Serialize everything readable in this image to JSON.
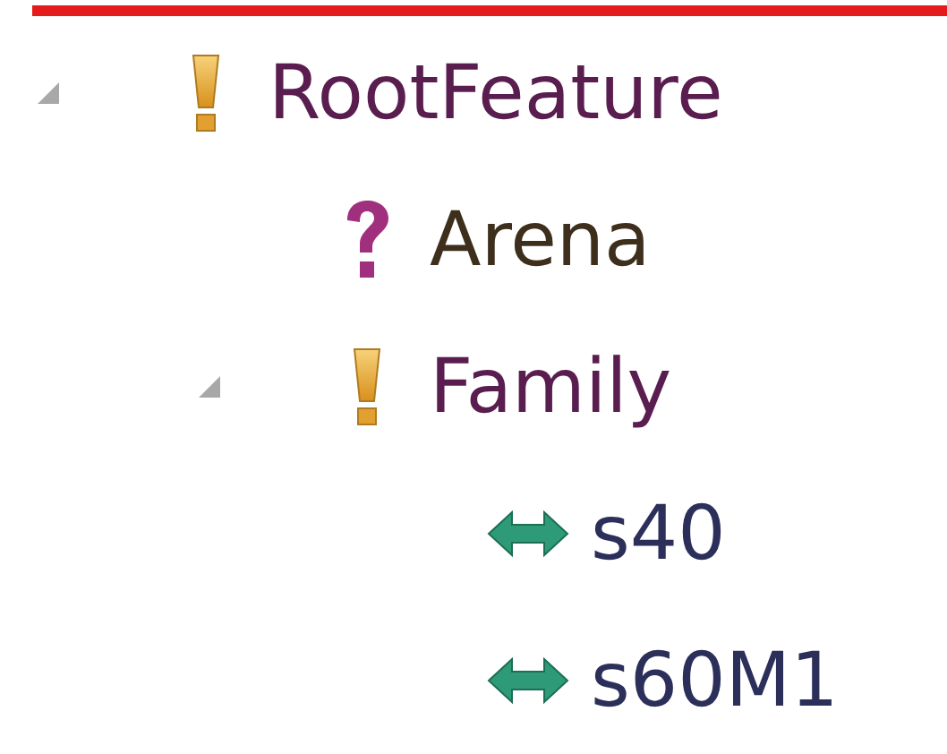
{
  "tree": [
    {
      "label": "RootFeature",
      "kind": "mandatory",
      "expanded": true,
      "children": [
        {
          "label": "Arena",
          "kind": "optional"
        },
        {
          "label": "Family",
          "kind": "mandatory",
          "expanded": true,
          "children": [
            {
              "label": "s40",
              "kind": "alternative"
            },
            {
              "label": "s60M1",
              "kind": "alternative"
            }
          ]
        }
      ]
    }
  ]
}
